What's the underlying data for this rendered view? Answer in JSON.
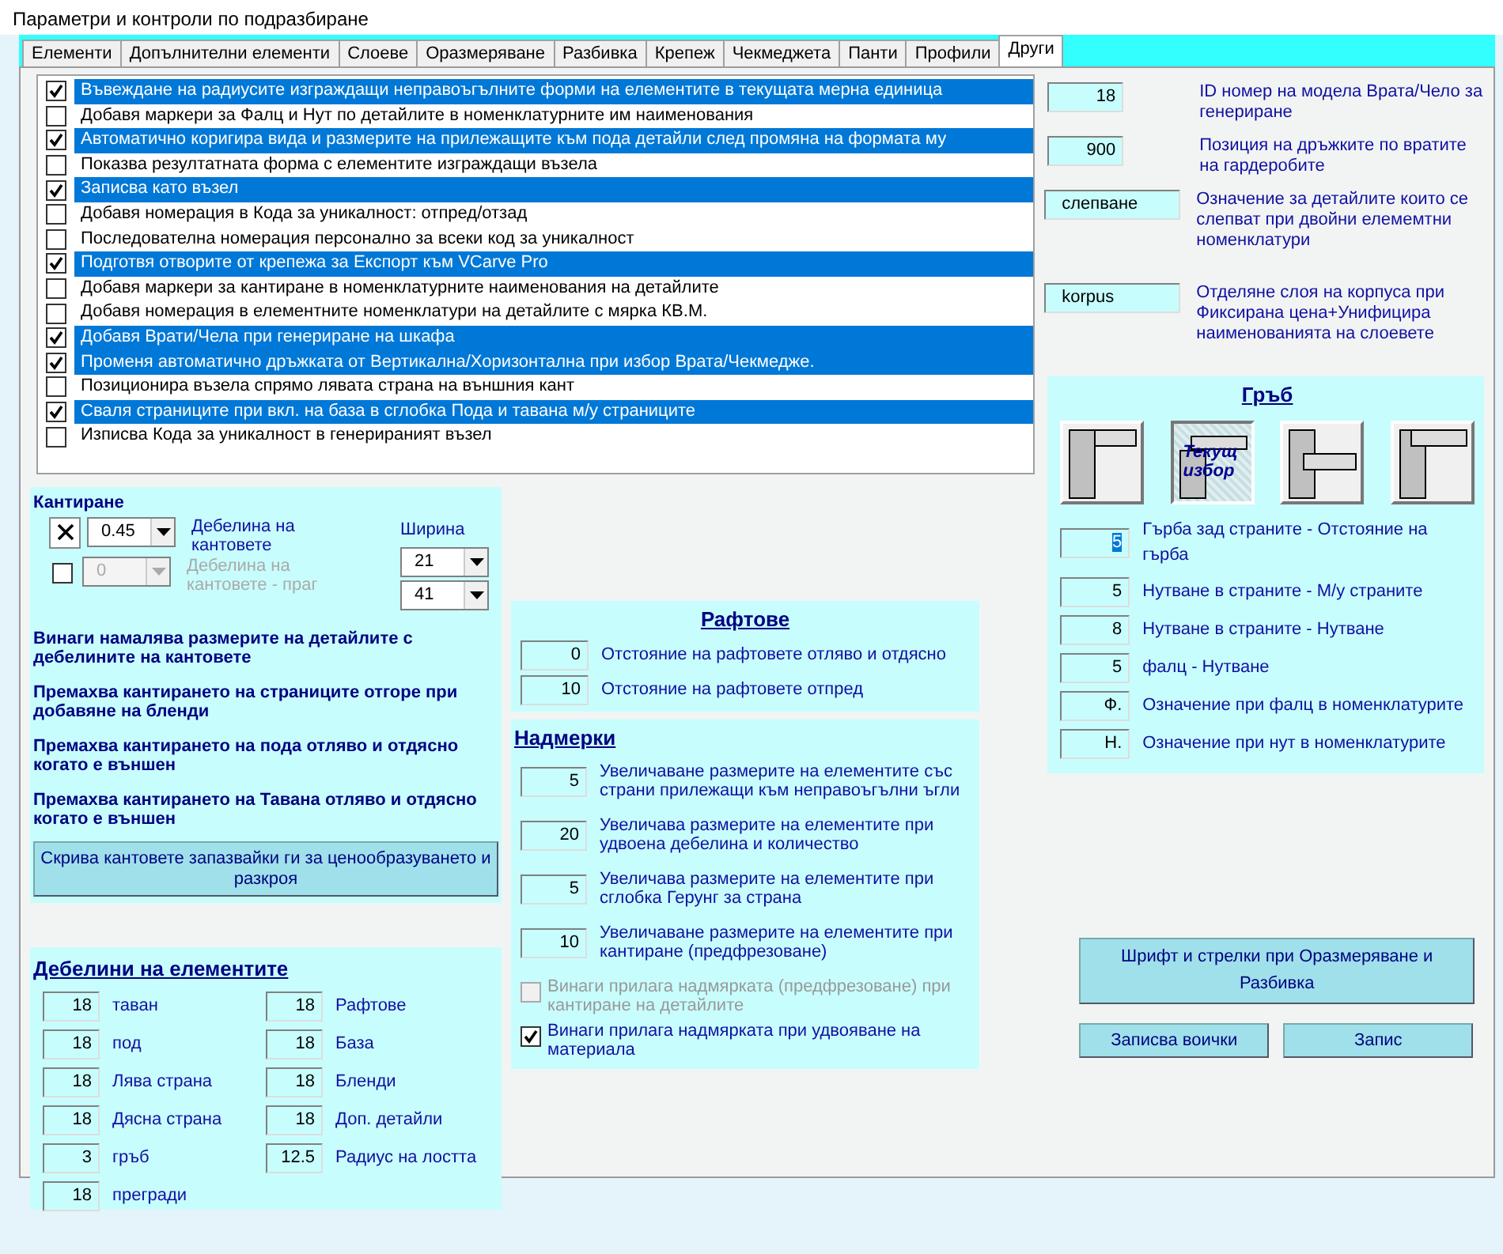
{
  "window": {
    "title": "Параметри и контроли по подразбиране"
  },
  "tabs": [
    {
      "label": "Елементи",
      "selected": false
    },
    {
      "label": "Допълнителни елементи",
      "selected": false
    },
    {
      "label": "Слоеве",
      "selected": false
    },
    {
      "label": "Оразмеряване",
      "selected": false
    },
    {
      "label": "Разбивка",
      "selected": false
    },
    {
      "label": "Крепеж",
      "selected": false
    },
    {
      "label": "Чекмеджета",
      "selected": false
    },
    {
      "label": "Панти",
      "selected": false
    },
    {
      "label": "Профили",
      "selected": false
    },
    {
      "label": "Други",
      "selected": true
    }
  ],
  "options": [
    {
      "label": "Въвеждане на радиусите изграждащи неправоъгълните форми на елементите в текущата мерна единица",
      "checked": true,
      "selected": true
    },
    {
      "label": "Добавя маркери за Фалц и Нут по детайлите в номенклатурните им наименования",
      "checked": false,
      "selected": false
    },
    {
      "label": "Автоматично коригира вида и размерите на прилежащите към пода детайли след промяна на формата му",
      "checked": true,
      "selected": true
    },
    {
      "label": "Показва резултатната форма с елементите изграждащи възела",
      "checked": false,
      "selected": false
    },
    {
      "label": "Записва като възел",
      "checked": true,
      "selected": true
    },
    {
      "label": "Добавя номерация в Кода за уникалност: отпред/отзад",
      "checked": false,
      "selected": false
    },
    {
      "label": "Последователна номерация персонално за всеки код за уникалност",
      "checked": false,
      "selected": false
    },
    {
      "label": "Подготвя отворите от крепежа за Експорт към VCarve Pro",
      "checked": true,
      "selected": true
    },
    {
      "label": "Добавя маркери за кантиране в номенклатурните наименования на детайлите",
      "checked": false,
      "selected": false
    },
    {
      "label": "Добавя номерация в елементните номенклатури на детайлите с мярка КВ.М.",
      "checked": false,
      "selected": false
    },
    {
      "label": "Добавя Врати/Чела при генериране на шкафа",
      "checked": true,
      "selected": true
    },
    {
      "label": "Променя автоматично дръжката от Вертикална/Хоризонтална при избор Врата/Чекмедже.",
      "checked": true,
      "selected": true
    },
    {
      "label": "Позиционира възела спрямо лявата страна на външния кант",
      "checked": false,
      "selected": false
    },
    {
      "label": "Сваля страниците при вкл. на база в сглобка Пода и тавана м/у страниците",
      "checked": true,
      "selected": true
    },
    {
      "label": "Изписва Кода за уникалност в генерираният възел",
      "checked": false,
      "selected": false
    }
  ],
  "edging": {
    "title": "Кантиране",
    "rows": [
      {
        "checked": true,
        "value": "0.45",
        "label": "Дебелина на кантовете",
        "disabled": false
      },
      {
        "checked": false,
        "value": "0",
        "label": "Дебелина на кантовете - праг",
        "disabled": true
      }
    ],
    "width_label": "Ширина",
    "widths": [
      "21",
      "41"
    ],
    "notes": [
      "Винаги намалява размерите на детайлите с дебелините на кантовете",
      "Премахва кантирането на страниците отгоре при добавяне на бленди",
      "Премахва кантирането на пода отляво и отдясно когато е външен",
      "Премахва кантирането на Тавана отляво и отдясно когато е външен"
    ],
    "button": "Скрива кантовете запазвайки ги за ценообразуването и разкроя"
  },
  "thicknesses": {
    "title": "Дебелини на елементите",
    "left": [
      {
        "value": "18",
        "label": "таван"
      },
      {
        "value": "18",
        "label": "под"
      },
      {
        "value": "18",
        "label": "Лява страна"
      },
      {
        "value": "18",
        "label": "Дясна страна"
      },
      {
        "value": "3",
        "label": "гръб"
      },
      {
        "value": "18",
        "label": "прегради"
      }
    ],
    "right": [
      {
        "value": "18",
        "label": "Рафтове"
      },
      {
        "value": "18",
        "label": "База"
      },
      {
        "value": "18",
        "label": "Бленди"
      },
      {
        "value": "18",
        "label": "Доп. детайли"
      },
      {
        "value": "12.5",
        "label": "Радиус на лостта"
      }
    ]
  },
  "shelves": {
    "title": "Рафтове",
    "fields": [
      {
        "value": "0",
        "label": "Отстояние на рафтовете отляво и отдясно"
      },
      {
        "value": "10",
        "label": "Отстояние на рафтовете отпред"
      }
    ]
  },
  "allowances": {
    "title": "Надмерки",
    "fields": [
      {
        "value": "5",
        "label": "Увеличаване размерите на елементите със страни прилежащи към неправоъгълни ъгли"
      },
      {
        "value": "20",
        "label": "Увеличава размерите на елементите при удвоена дебелина и количество"
      },
      {
        "value": "5",
        "label": "Увеличава размерите на елементите при сглобка Герунг за страна"
      },
      {
        "value": "10",
        "label": "Увеличаване размерите на елементите при кантиране (предфрезоване)"
      }
    ],
    "options": [
      {
        "label": "Винаги прилага надмярката (предфрезоване) при кантиране на детайлите",
        "checked": false,
        "disabled": true
      },
      {
        "label": "Винаги прилага надмярката при удвояване на материала",
        "checked": true,
        "disabled": false
      }
    ]
  },
  "general_fields": [
    {
      "value": "18",
      "label": "ID номер на модела Врата/Чело за генериране",
      "kind": "number"
    },
    {
      "value": "900",
      "label": "Позиция на дръжките по вратите на гардеробите",
      "kind": "number"
    },
    {
      "value": "слепване",
      "label": "Означение за детайлите които се слепват при двойни елемемтни номенклатури",
      "kind": "text"
    },
    {
      "value": "korpus",
      "label": "Отделяне слоя на корпуса при Фиксирана цена+Унифицира наименованията на слоевете",
      "kind": "text"
    }
  ],
  "back": {
    "title": "Гръб",
    "styles": [
      {
        "kind": "behind",
        "selected": false
      },
      {
        "kind": "inset",
        "selected": true,
        "caption": "Текущ избор"
      },
      {
        "kind": "groove",
        "selected": false
      },
      {
        "kind": "rebate",
        "selected": false
      }
    ],
    "fields": [
      {
        "value": "5",
        "label": "Гърба зад страните - Отстояние на гърба",
        "focused": true
      },
      {
        "value": "5",
        "label": "Нутване в страните - М/у страните",
        "focused": false
      },
      {
        "value": "8",
        "label": "Нутване в страните - Нутване",
        "focused": false
      },
      {
        "value": "5",
        "label": "фалц - Нутване",
        "focused": false
      },
      {
        "value": "Ф.",
        "label": "Означение при фалц в номенклатурите",
        "focused": false
      },
      {
        "value": "Н.",
        "label": "Означение при нут в номенклатурите",
        "focused": false
      }
    ]
  },
  "buttons": {
    "font": "Шрифт и стрелки при Оразмеряване и Разбивка",
    "save_all": "Записва воички",
    "save": "Запис"
  }
}
